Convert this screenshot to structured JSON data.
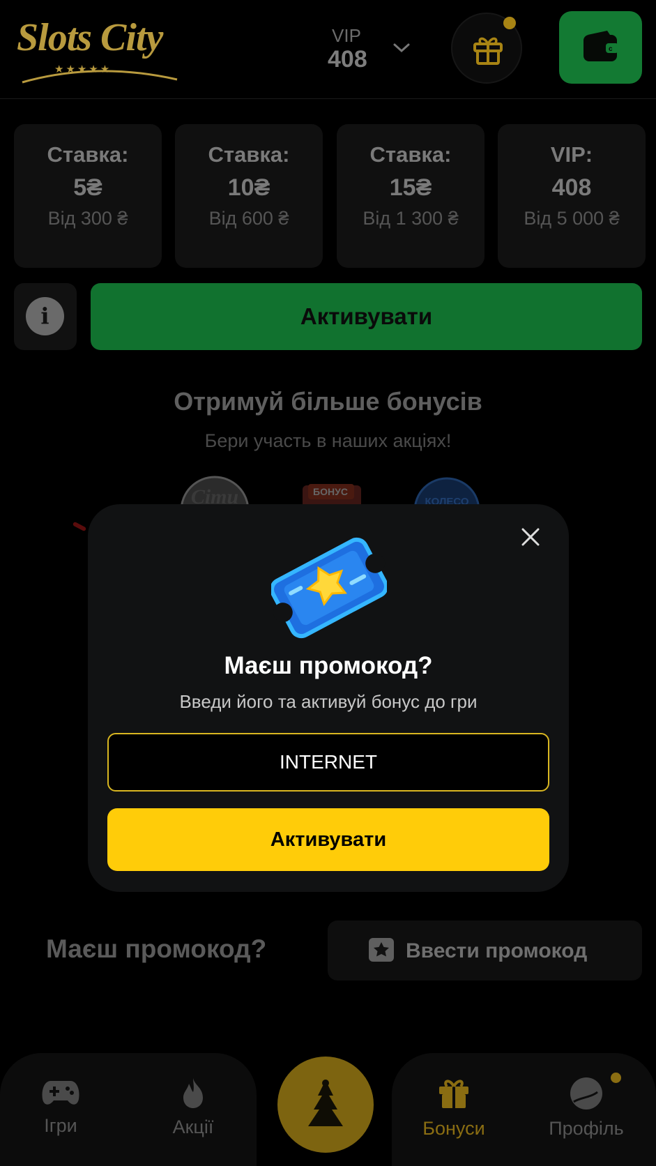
{
  "header": {
    "logo_text": "Slots City",
    "logo_stars": "★★★★★",
    "vip_label": "VIP",
    "vip_value": "408",
    "colors": {
      "logo_gold": "#b89a3e",
      "wallet_green": "#137a33"
    }
  },
  "stake_cards": [
    {
      "title": "Ставка:",
      "amount": "5₴",
      "min": "Від 300 ₴"
    },
    {
      "title": "Ставка:",
      "amount": "10₴",
      "min": "Від 600 ₴"
    },
    {
      "title": "Ставка:",
      "amount": "15₴",
      "min": "Від 1 300 ₴"
    },
    {
      "title": "VIP:",
      "amount": "408",
      "min": "Від 5 000 ₴"
    }
  ],
  "info_label": "i",
  "activate_label": "Активувати",
  "promotions": {
    "title": "Отримуй більше бонусів",
    "subtitle": "Бери участь в наших акціях!",
    "icons": [
      {
        "name": "sloty-icon",
        "text": "Сіти"
      },
      {
        "name": "bonus-icon",
        "text": "БОНУС"
      },
      {
        "name": "wheel-icon",
        "text": "КОЛЕСО"
      }
    ]
  },
  "promo_question": "Маєш промокод?",
  "enter_promo_label": "Ввести промокод",
  "bottom_nav": {
    "items": [
      {
        "label": "Ігри",
        "icon": "gamepad-icon"
      },
      {
        "label": "Акції",
        "icon": "flame-icon"
      },
      {
        "label": "Бонуси",
        "icon": "gift-icon",
        "active": true
      },
      {
        "label": "Профіль",
        "icon": "profile-icon"
      }
    ],
    "active_color": "#8a6d12"
  },
  "modal": {
    "title": "Маєш промокод?",
    "subtitle": "Введи його та активуй бонус до гри",
    "input_value": "INTERNET",
    "button_label": "Активувати",
    "accent_color": "#ffcc09"
  }
}
